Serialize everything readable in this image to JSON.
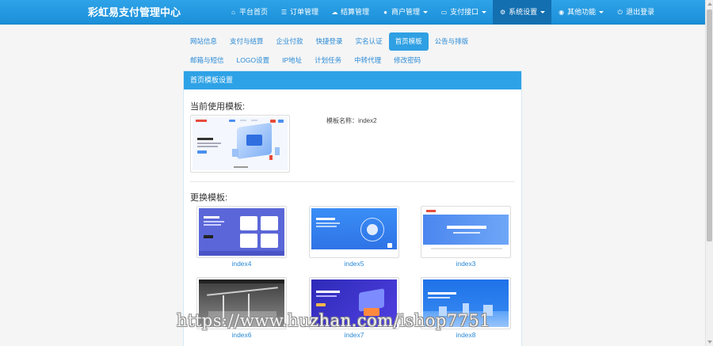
{
  "brand": "彩虹易支付管理中心",
  "nav": [
    {
      "icon": "home-icon",
      "glyph": "⌂",
      "label": "平台首页"
    },
    {
      "icon": "list-icon",
      "glyph": "☰",
      "label": "订单管理"
    },
    {
      "icon": "cloud-icon",
      "glyph": "☁",
      "label": "结算管理"
    },
    {
      "icon": "user-icon",
      "glyph": "●",
      "label": "商户管理"
    },
    {
      "icon": "card-icon",
      "glyph": "▭",
      "label": "支付接口"
    },
    {
      "icon": "gear-icon",
      "glyph": "⚙",
      "label": "系统设置"
    },
    {
      "icon": "globe-icon",
      "glyph": "◉",
      "label": "其他功能"
    },
    {
      "icon": "power-icon",
      "glyph": "⏻",
      "label": "退出登录"
    }
  ],
  "tabs_row1": [
    "网站信息",
    "支付与结算",
    "企业付款",
    "快捷登录",
    "实名认证",
    "首页模板",
    "公告与排版"
  ],
  "tabs_row2": [
    "邮箱与短信",
    "LOGO设置",
    "IP地址",
    "计划任务",
    "中转代理",
    "修改密码"
  ],
  "active_tab": "首页模板",
  "panel": {
    "title": "首页模板设置",
    "current_title": "当前使用模板:",
    "template_name_label": "模板名称：",
    "template_name_value": "index2",
    "change_title": "更换模板:"
  },
  "templates": [
    "index4",
    "index5",
    "index3",
    "index6",
    "index7",
    "index8"
  ],
  "watermark": "https://www.huzhan.com/ishop7751",
  "colors": {
    "primary": "#2fa0e3",
    "link": "#2a8ad6",
    "active_nav": "#136fb0"
  }
}
